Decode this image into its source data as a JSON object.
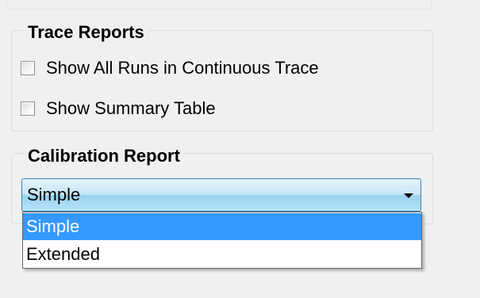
{
  "trace_reports": {
    "title": "Trace Reports",
    "options": [
      {
        "label": "Show All Runs in Continuous Trace",
        "checked": false
      },
      {
        "label": "Show Summary Table",
        "checked": false
      }
    ]
  },
  "calibration_report": {
    "title": "Calibration Report",
    "selected": "Simple",
    "options": [
      "Simple",
      "Extended"
    ],
    "highlight_color": "#3399ff"
  }
}
